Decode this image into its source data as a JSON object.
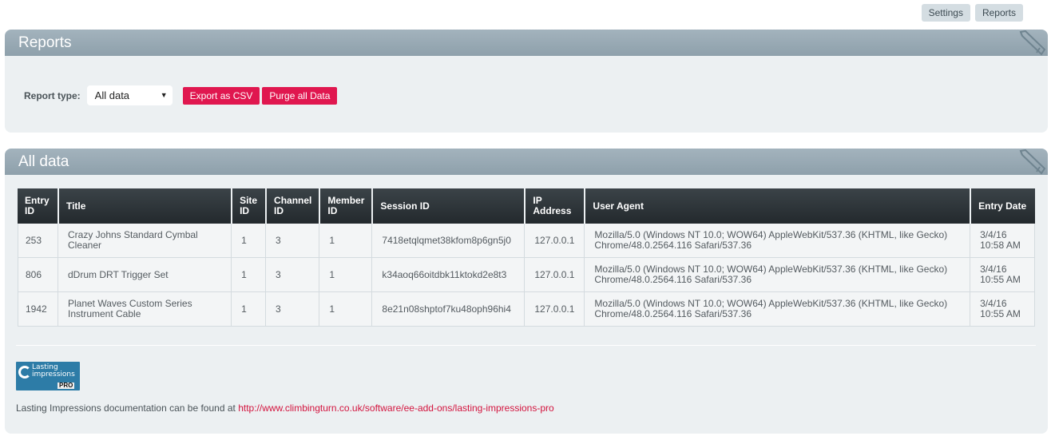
{
  "nav": {
    "settings": "Settings",
    "reports": "Reports"
  },
  "reports_panel": {
    "title": "Reports",
    "report_type_label": "Report type:",
    "report_type_value": "All data",
    "export_label": "Export as CSV",
    "purge_label": "Purge all Data"
  },
  "data_panel": {
    "title": "All data",
    "columns": [
      [
        "Entry",
        "ID"
      ],
      [
        "Title"
      ],
      [
        "Site",
        "ID"
      ],
      [
        "Channel",
        "ID"
      ],
      [
        "Member",
        "ID"
      ],
      [
        "Session ID"
      ],
      [
        "IP",
        "Address"
      ],
      [
        "User Agent"
      ],
      [
        "Entry Date"
      ]
    ],
    "rows": [
      {
        "entry_id": "253",
        "title": [
          "Crazy Johns Standard Cymbal",
          "Cleaner"
        ],
        "site_id": "1",
        "channel_id": "3",
        "member_id": "1",
        "session_id": "7418etqlqmet38kfom8p6gn5j0",
        "ip": "127.0.0.1",
        "user_agent": [
          "Mozilla/5.0 (Windows NT 10.0; WOW64) AppleWebKit/537.36 (KHTML, like Gecko)",
          "Chrome/48.0.2564.116 Safari/537.36"
        ],
        "entry_date": [
          "3/4/16",
          "10:58 AM"
        ]
      },
      {
        "entry_id": "806",
        "title": [
          "dDrum DRT Trigger Set"
        ],
        "site_id": "1",
        "channel_id": "3",
        "member_id": "1",
        "session_id": "k34aoq66oitdbk11ktokd2e8t3",
        "ip": "127.0.0.1",
        "user_agent": [
          "Mozilla/5.0 (Windows NT 10.0; WOW64) AppleWebKit/537.36 (KHTML, like Gecko)",
          "Chrome/48.0.2564.116 Safari/537.36"
        ],
        "entry_date": [
          "3/4/16",
          "10:55 AM"
        ]
      },
      {
        "entry_id": "1942",
        "title": [
          "Planet Waves Custom Series",
          "Instrument Cable"
        ],
        "site_id": "1",
        "channel_id": "3",
        "member_id": "1",
        "session_id": "8e21n08shptof7ku48oph96hi4",
        "ip": "127.0.0.1",
        "user_agent": [
          "Mozilla/5.0 (Windows NT 10.0; WOW64) AppleWebKit/537.36 (KHTML, like Gecko)",
          "Chrome/48.0.2564.116 Safari/537.36"
        ],
        "entry_date": [
          "3/4/16",
          "10:55 AM"
        ]
      }
    ]
  },
  "footer": {
    "logo_text": [
      "Lasting",
      "impressions"
    ],
    "logo_pro": "PRO",
    "docs_text": "Lasting Impressions documentation can be found at ",
    "docs_link": "http://www.climbingturn.co.uk/software/ee-add-ons/lasting-impressions-pro"
  },
  "colors": {
    "accent": "#e0174f",
    "header_bar": "#8ea0ab",
    "table_head": "#2b3236",
    "link": "#d3143e"
  },
  "icons": {
    "panel_corner": "pencil-icon",
    "select_caret": "caret-down-icon"
  }
}
